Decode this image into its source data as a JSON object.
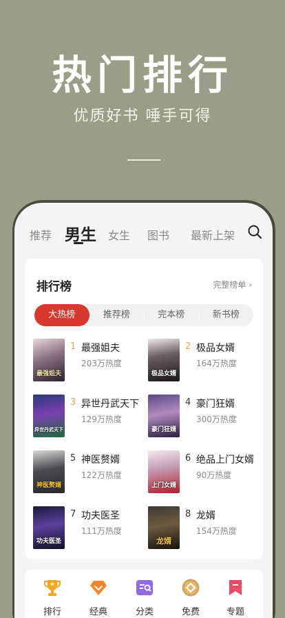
{
  "hero": {
    "title": "热门排行",
    "subtitle": "优质好书  唾手可得"
  },
  "tabs": [
    {
      "label": "推荐",
      "active": false
    },
    {
      "label": "男生",
      "active": true
    },
    {
      "label": "女生",
      "active": false
    },
    {
      "label": "图书",
      "active": false
    },
    {
      "label": "最新上架",
      "active": false
    }
  ],
  "ranking": {
    "title": "排行榜",
    "more": "完整榜单 ›",
    "segments": [
      "大热榜",
      "推荐榜",
      "完本榜",
      "新书榜"
    ],
    "active_segment": "大热榜",
    "books": [
      {
        "rank": "1",
        "name": "最强姐夫",
        "heat": "203万热度",
        "cover_text": "最强姐夫"
      },
      {
        "rank": "2",
        "name": "极品女婿",
        "heat": "164万热度",
        "cover_text": "极品女婿"
      },
      {
        "rank": "3",
        "name": "异世丹武天下",
        "heat": "129万热度",
        "cover_text": "异世丹武天下"
      },
      {
        "rank": "4",
        "name": "豪门狂婿",
        "heat": "300万热度",
        "cover_text": "豪门狂婿"
      },
      {
        "rank": "5",
        "name": "神医赘婿",
        "heat": "122万热度",
        "cover_text": "神医赘婿"
      },
      {
        "rank": "6",
        "name": "绝品上门女婿",
        "heat": "90万热度",
        "cover_text": "上门女婿"
      },
      {
        "rank": "7",
        "name": "功夫医圣",
        "heat": "111万热度",
        "cover_text": "功夫医圣"
      },
      {
        "rank": "8",
        "name": "龙婿",
        "heat": "154万热度",
        "cover_text": "龙婿"
      }
    ]
  },
  "bottom_nav": [
    {
      "label": "排行",
      "icon": "trophy-icon"
    },
    {
      "label": "经典",
      "icon": "diamond-icon"
    },
    {
      "label": "分类",
      "icon": "category-search-icon"
    },
    {
      "label": "免费",
      "icon": "coin-icon"
    },
    {
      "label": "专题",
      "icon": "bookmark-icon"
    }
  ],
  "colors": {
    "background": "#9a9d87",
    "accent": "#d9382f",
    "rank_gold": "#e0a75b"
  }
}
